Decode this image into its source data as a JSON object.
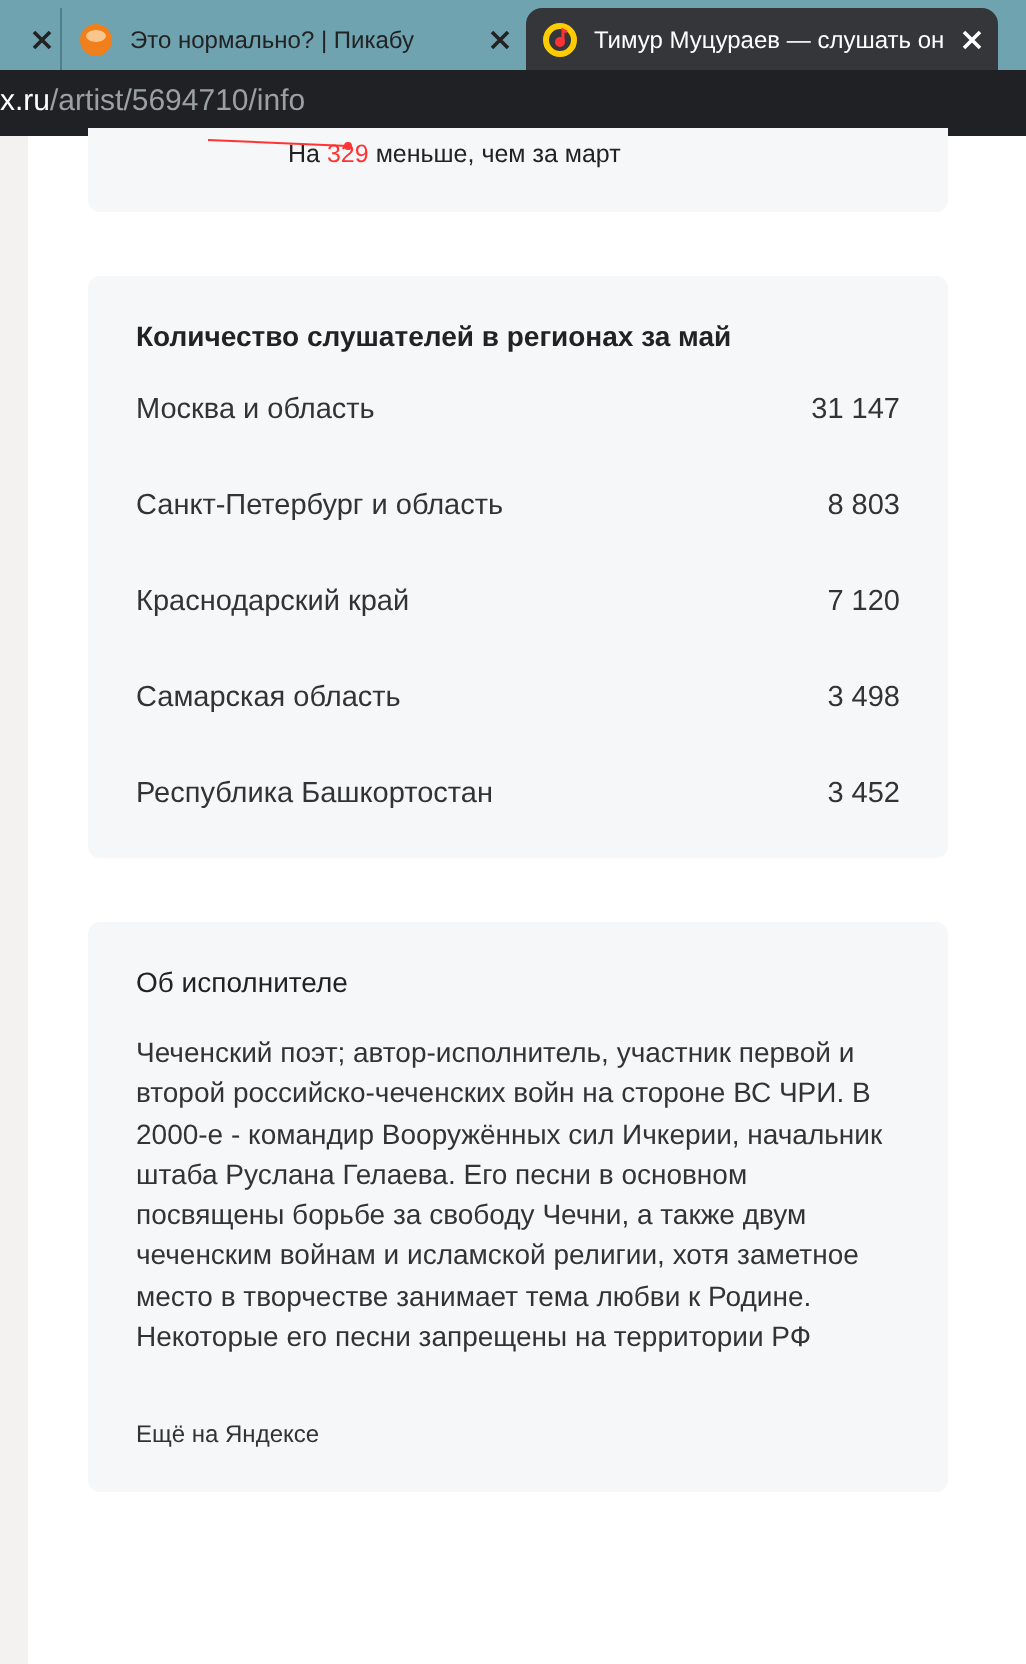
{
  "tabs": [
    {
      "kind": "blank",
      "selected": false
    },
    {
      "title": "Это нормально? | Пикабу",
      "selected": false,
      "kind": "pikabu"
    },
    {
      "title": "Тимур Муцураев — слушать он",
      "selected": true,
      "kind": "music"
    }
  ],
  "address": {
    "host": "x.ru",
    "path": "/artist/5694710/info"
  },
  "stats_card": {
    "prefix": "На",
    "number": "329",
    "suffix": "меньше, чем за март"
  },
  "regions_card": {
    "title": "Количество слушателей в регионах за май",
    "rows": [
      {
        "region": "Москва и область",
        "count": "31 147"
      },
      {
        "region": "Санкт-Петербург и область",
        "count": "8 803"
      },
      {
        "region": "Краснодарский край",
        "count": "7 120"
      },
      {
        "region": "Самарская область",
        "count": "3 498"
      },
      {
        "region": "Республика Башкортостан",
        "count": "3 452"
      }
    ]
  },
  "about_card": {
    "title": "Об исполнителе",
    "text": "Чеченский поэт; автор-исполнитель, участник первой и второй российско-чеченских войн на стороне ВС ЧРИ. В 2000-е - командир Вооружённых сил Ичкерии, начальник штаба Руслана Гелаева. Его песни в основном посвящены борьбе за свободу Чечни, а также двум чеченским войнам и исламской религии, хотя заметное место в творчестве занимает тема любви к Родине. Некоторые его песни запрещены на территории РФ",
    "link": "Ещё на Яндексе"
  }
}
